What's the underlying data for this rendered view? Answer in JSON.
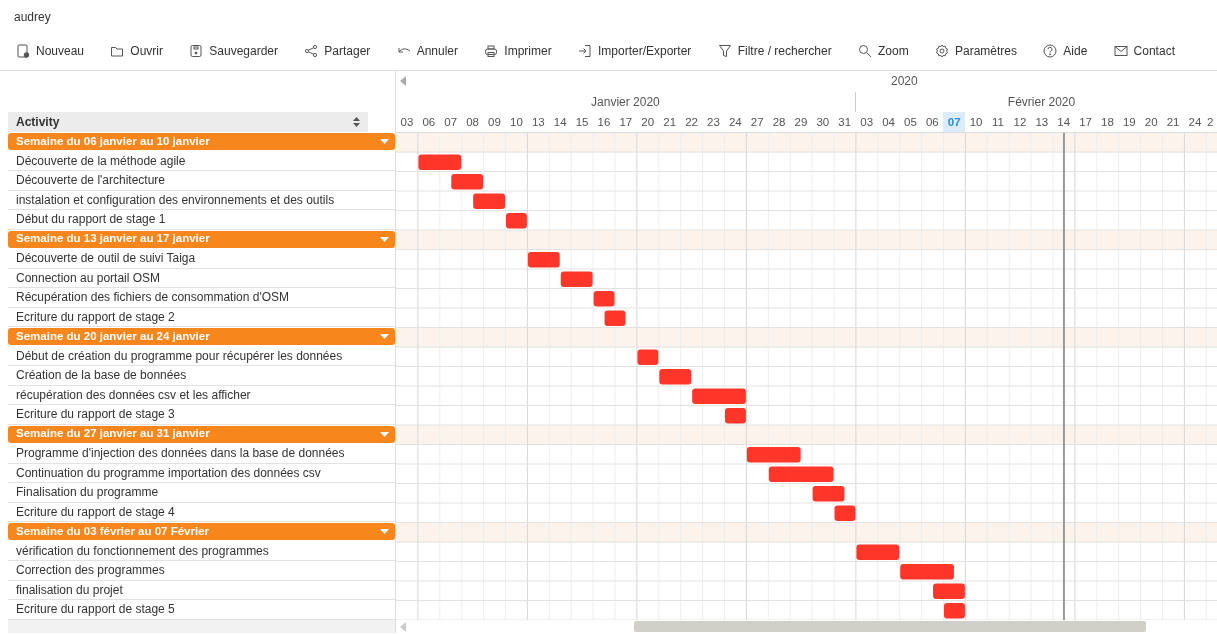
{
  "user": "audrey",
  "toolbar": [
    {
      "kind": "new",
      "label": "Nouveau"
    },
    {
      "kind": "open",
      "label": "Ouvrir"
    },
    {
      "kind": "save",
      "label": "Sauvegarder"
    },
    {
      "kind": "share",
      "label": "Partager"
    },
    {
      "kind": "undo",
      "label": "Annuler"
    },
    {
      "kind": "print",
      "label": "Imprimer"
    },
    {
      "kind": "import",
      "label": "Importer/Exporter"
    },
    {
      "kind": "filter",
      "label": "Filtre / rechercher"
    },
    {
      "kind": "zoom",
      "label": "Zoom"
    },
    {
      "kind": "settings",
      "label": "Paramètres"
    },
    {
      "kind": "help",
      "label": "Aide"
    },
    {
      "kind": "contact",
      "label": "Contact"
    }
  ],
  "activity_header": "Activity",
  "timeline": {
    "year": "2020",
    "months": [
      {
        "label": "Janvier 2020",
        "days": [
          {
            "label": "03",
            "selected": false
          },
          {
            "label": "06",
            "selected": false
          },
          {
            "label": "07",
            "selected": false
          },
          {
            "label": "08",
            "selected": false
          },
          {
            "label": "09",
            "selected": false
          },
          {
            "label": "10",
            "selected": false
          },
          {
            "label": "13",
            "selected": false
          },
          {
            "label": "14",
            "selected": false
          },
          {
            "label": "15",
            "selected": false
          },
          {
            "label": "16",
            "selected": false
          },
          {
            "label": "17",
            "selected": false
          },
          {
            "label": "20",
            "selected": false
          },
          {
            "label": "21",
            "selected": false
          },
          {
            "label": "22",
            "selected": false
          },
          {
            "label": "23",
            "selected": false
          },
          {
            "label": "24",
            "selected": false
          },
          {
            "label": "27",
            "selected": false
          },
          {
            "label": "28",
            "selected": false
          },
          {
            "label": "29",
            "selected": false
          },
          {
            "label": "30",
            "selected": false
          },
          {
            "label": "31",
            "selected": false
          }
        ]
      },
      {
        "label": "Février 2020",
        "days": [
          {
            "label": "03",
            "selected": false
          },
          {
            "label": "04",
            "selected": false
          },
          {
            "label": "05",
            "selected": false
          },
          {
            "label": "06",
            "selected": false
          },
          {
            "label": "07",
            "selected": true
          },
          {
            "label": "10",
            "selected": false
          },
          {
            "label": "11",
            "selected": false
          },
          {
            "label": "12",
            "selected": false
          },
          {
            "label": "13",
            "selected": false
          },
          {
            "label": "14",
            "selected": false
          },
          {
            "label": "17",
            "selected": false
          },
          {
            "label": "18",
            "selected": false
          },
          {
            "label": "19",
            "selected": false
          },
          {
            "label": "20",
            "selected": false
          },
          {
            "label": "21",
            "selected": false
          },
          {
            "label": "24",
            "selected": false
          },
          {
            "label": "2",
            "selected": false
          }
        ]
      }
    ]
  },
  "groups": [
    {
      "label": "Semaine du 06 janvier au 10 janvier",
      "expanded": true,
      "tasks": [
        {
          "label": "Découverte de la méthode agile"
        },
        {
          "label": "Découverte de l'architecture"
        },
        {
          "label": "instalation et configuration des environnements et des outils"
        },
        {
          "label": "Début du rapport de stage 1"
        }
      ]
    },
    {
      "label": "Semaine du 13 janvier  au  17 janvier",
      "expanded": true,
      "tasks": [
        {
          "label": "Découverte de outil de suivi Taiga"
        },
        {
          "label": "Connection au portail OSM"
        },
        {
          "label": "Récupération des fichiers de consommation d'OSM"
        },
        {
          "label": "Ecriture du rapport de stage 2"
        }
      ]
    },
    {
      "label": "Semaine du 20 janvier  au 24 janvier",
      "expanded": true,
      "tasks": [
        {
          "label": "Début de création du programme pour récupérer les données"
        },
        {
          "label": "Création de la base de bonnées"
        },
        {
          "label": "récupération des données csv et les afficher"
        },
        {
          "label": "Ecriture du rapport de stage 3"
        }
      ]
    },
    {
      "label": "Semaine du 27 janvier au 31 janvier",
      "expanded": true,
      "tasks": [
        {
          "label": "Programme d'injection des données dans la base de données"
        },
        {
          "label": "Continuation du programme importation des données csv"
        },
        {
          "label": "Finalisation du programme"
        },
        {
          "label": "Ecriture du rapport de stage 4"
        }
      ]
    },
    {
      "label": "Semaine du 03 février au 07 Février",
      "expanded": true,
      "tasks": [
        {
          "label": "vérification du fonctionnement des programmes"
        },
        {
          "label": "Correction des programmes"
        },
        {
          "label": "finalisation du projet"
        },
        {
          "label": "Ecriture du rapport de stage 5"
        }
      ]
    }
  ]
}
